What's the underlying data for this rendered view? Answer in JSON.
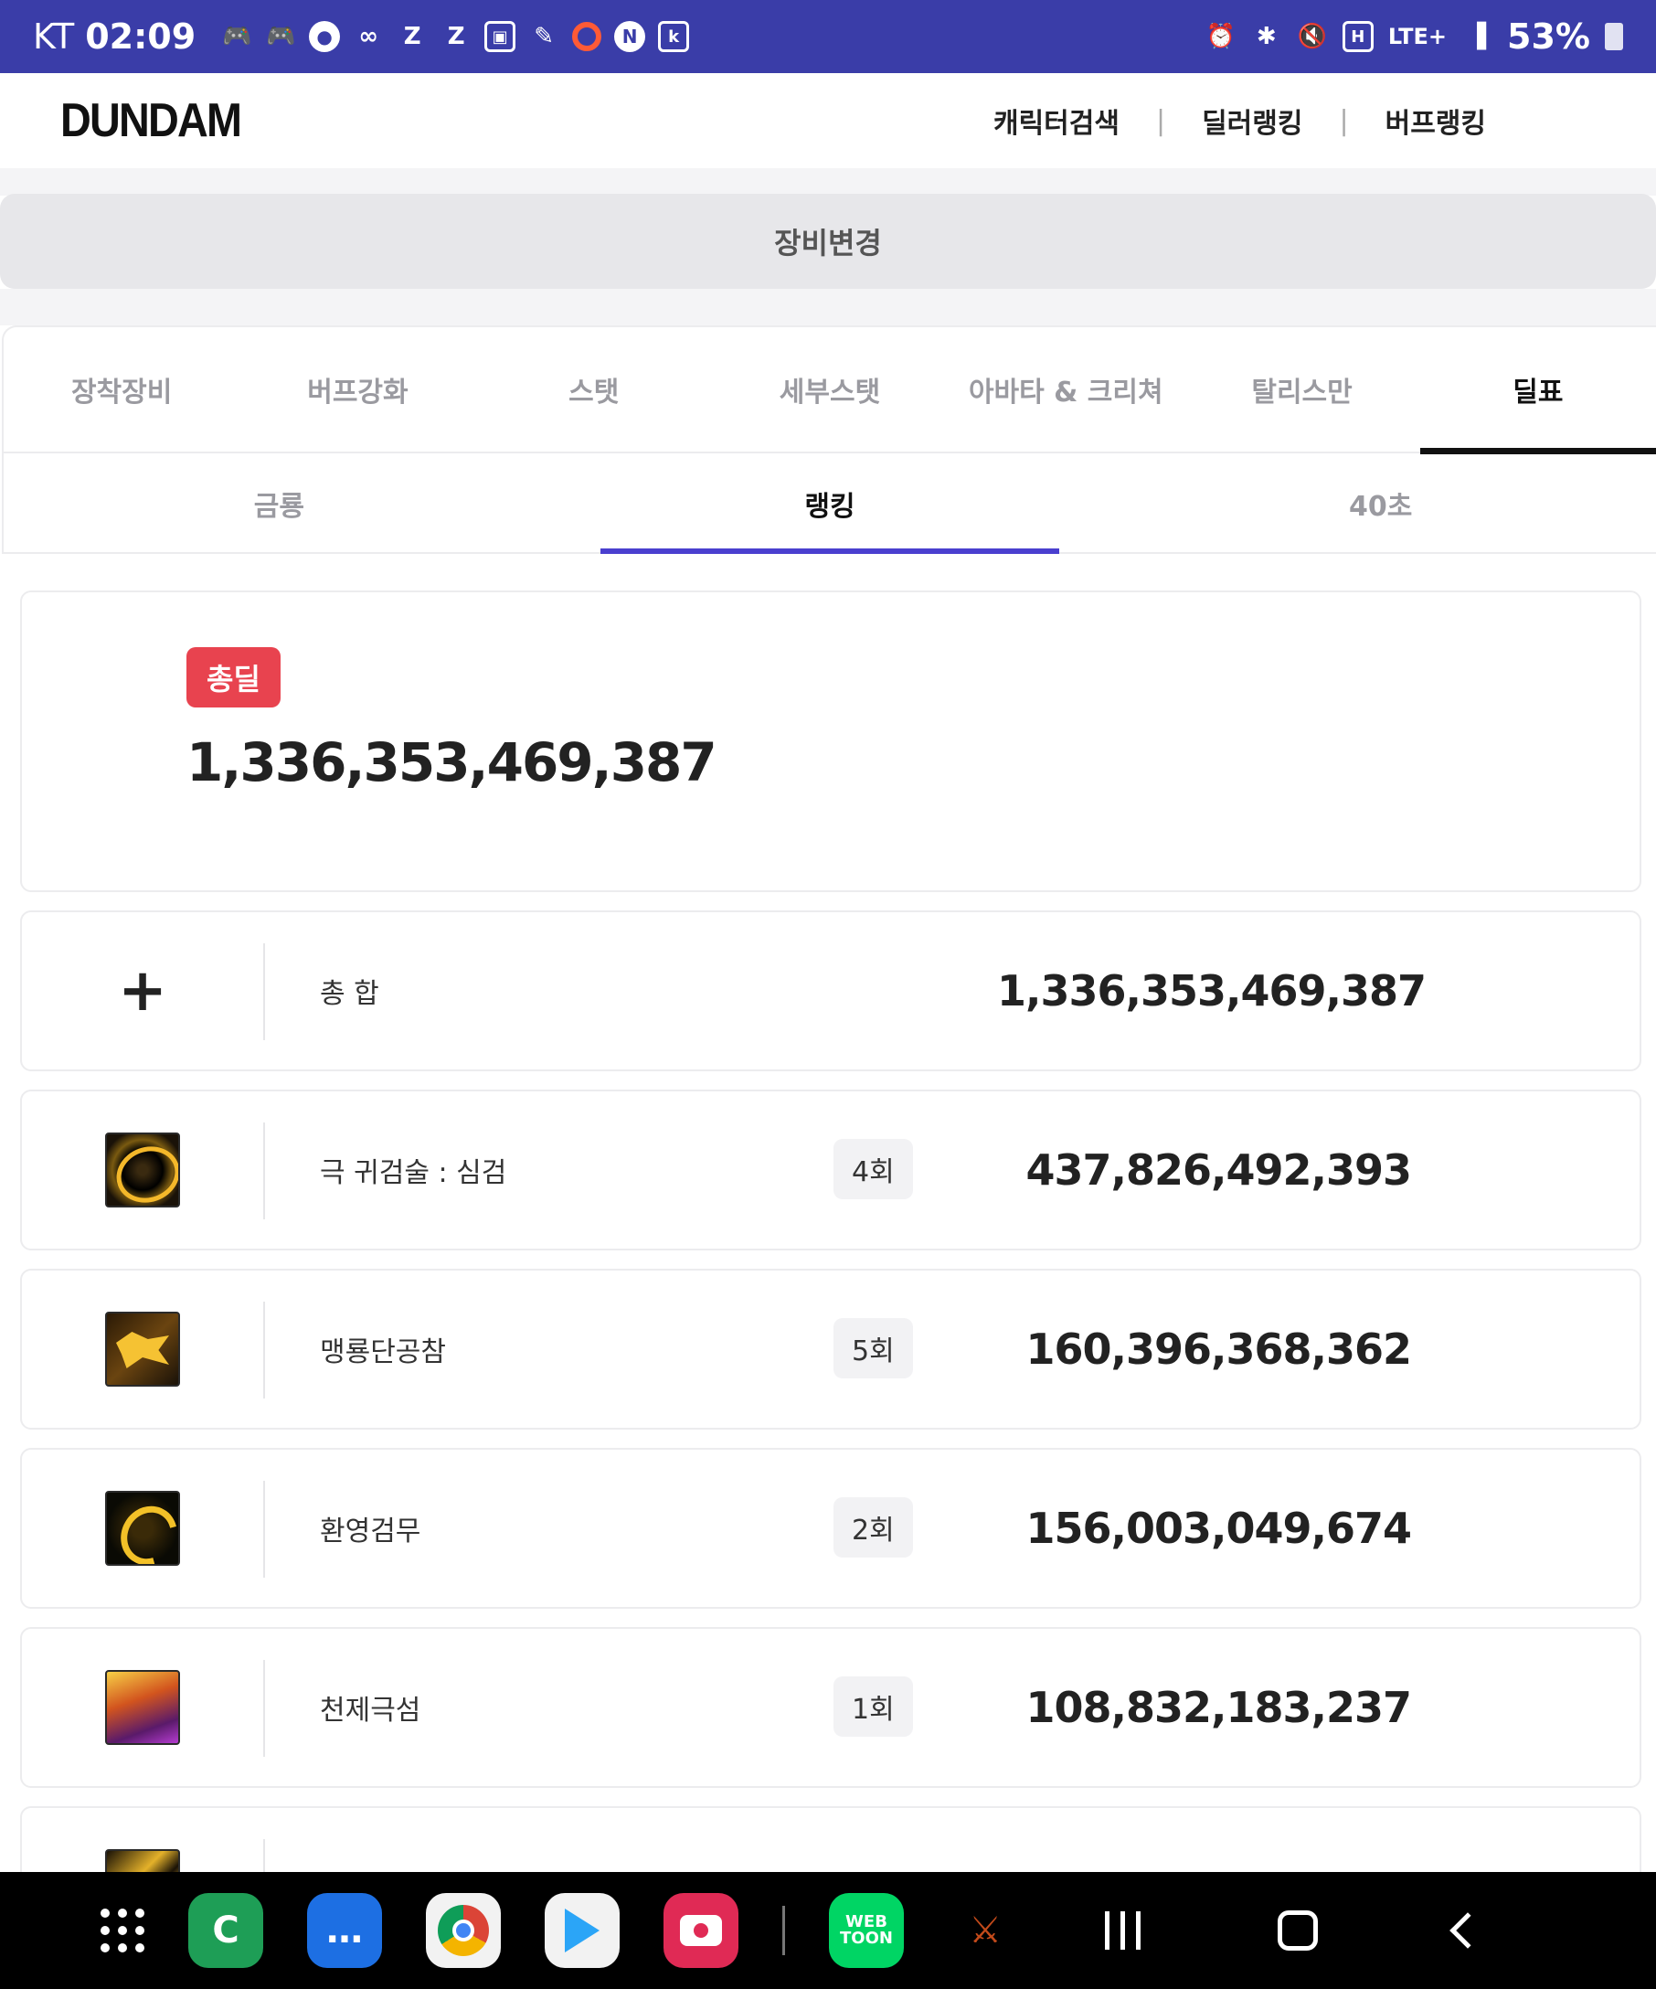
{
  "status_bar": {
    "carrier": "KT",
    "time": "02:09",
    "network": "LTE+",
    "battery": "53%"
  },
  "header": {
    "logo": "DUNDAM",
    "nav": [
      "캐릭터검색",
      "딜러랭킹",
      "버프랭킹"
    ]
  },
  "equip_button": "장비변경",
  "main_tabs": [
    "장착장비",
    "버프강화",
    "스탯",
    "세부스탯",
    "아바타 & 크리쳐",
    "탈리스만",
    "딜표"
  ],
  "sub_tabs": [
    "금룡",
    "랭킹",
    "40초"
  ],
  "total": {
    "badge": "총딜",
    "value": "1,336,353,469,387"
  },
  "rows": [
    {
      "icon": "plus-icon",
      "name": "총 합",
      "count": "",
      "damage": "1,336,353,469,387"
    },
    {
      "icon": "skill-icon",
      "name": "극 귀검술 : 심검",
      "count": "4회",
      "damage": "437,826,492,393"
    },
    {
      "icon": "skill-icon",
      "name": "맹룡단공참",
      "count": "5회",
      "damage": "160,396,368,362"
    },
    {
      "icon": "skill-icon",
      "name": "환영검무",
      "count": "2회",
      "damage": "156,003,049,674"
    },
    {
      "icon": "skill-icon",
      "name": "천제극섬",
      "count": "1회",
      "damage": "108,832,183,237"
    }
  ],
  "colors": {
    "status_bar": "#3a3da8",
    "badge": "#e8434f",
    "active_subtab_underline": "#4a3fcf"
  }
}
